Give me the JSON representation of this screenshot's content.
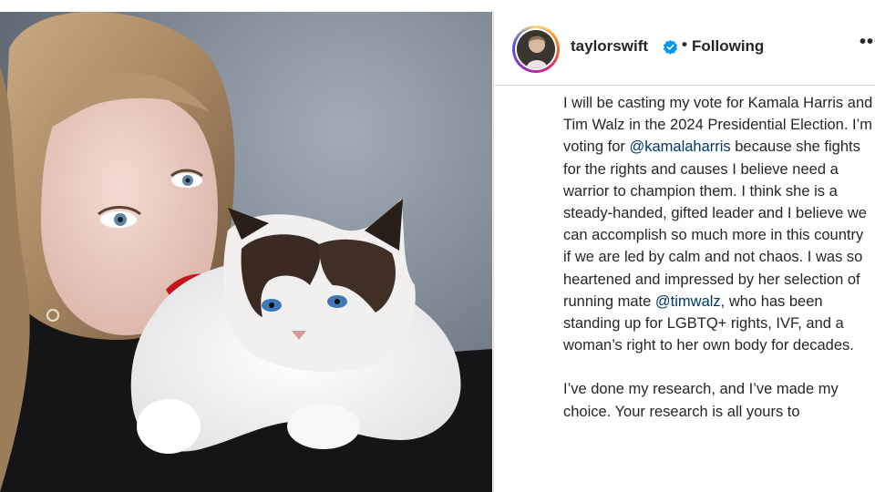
{
  "post": {
    "author": {
      "username": "taylorswift",
      "verified": true,
      "verified_icon": "verified-badge-icon",
      "separator": "•",
      "follow_status": "Following",
      "more_label": "•••"
    },
    "caption": {
      "p1_a": "I will be casting my vote for Kamala Harris and Tim Walz in the 2024 Presidential Election. I’m voting for ",
      "mention1": "@kamalaharris",
      "p1_b": " because she fights for the rights and causes I believe need a warrior to champion them. I think she is a steady-handed, gifted leader and I believe we can accomplish so much more in this country if we are led by calm and not chaos. I was so heartened and impressed by her selection of running mate ",
      "mention2": "@timwalz",
      "p1_c": ", who has been standing up for LGBTQ+ rights, IVF, and a woman’s right to her own body for decades.",
      "p2": "I’ve done my research, and I’ve made my choice. Your research is all yours to"
    },
    "colors": {
      "link": "#00376b",
      "verified": "#0095f6",
      "text": "#262626",
      "divider": "#dbdbdb"
    }
  }
}
